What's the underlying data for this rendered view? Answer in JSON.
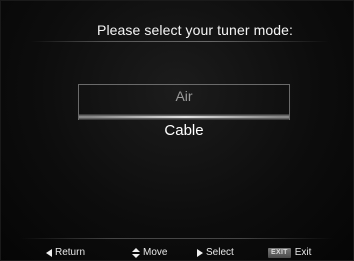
{
  "title": "Please select your tuner mode:",
  "options": [
    {
      "label": "Air",
      "selected": false
    },
    {
      "label": "Cable",
      "selected": true
    }
  ],
  "footer": {
    "return_label": "Return",
    "return_icon": "left-triangle-icon",
    "move_label": "Move",
    "move_icon": "up-down-arrow-icon",
    "select_label": "Select",
    "select_icon": "right-triangle-icon",
    "exit_key_label": "EXIT",
    "exit_label": "Exit"
  },
  "colors": {
    "background": "#0d0d0d",
    "text": "#f2f2f2",
    "unselected_text": "#9a9a9a"
  }
}
